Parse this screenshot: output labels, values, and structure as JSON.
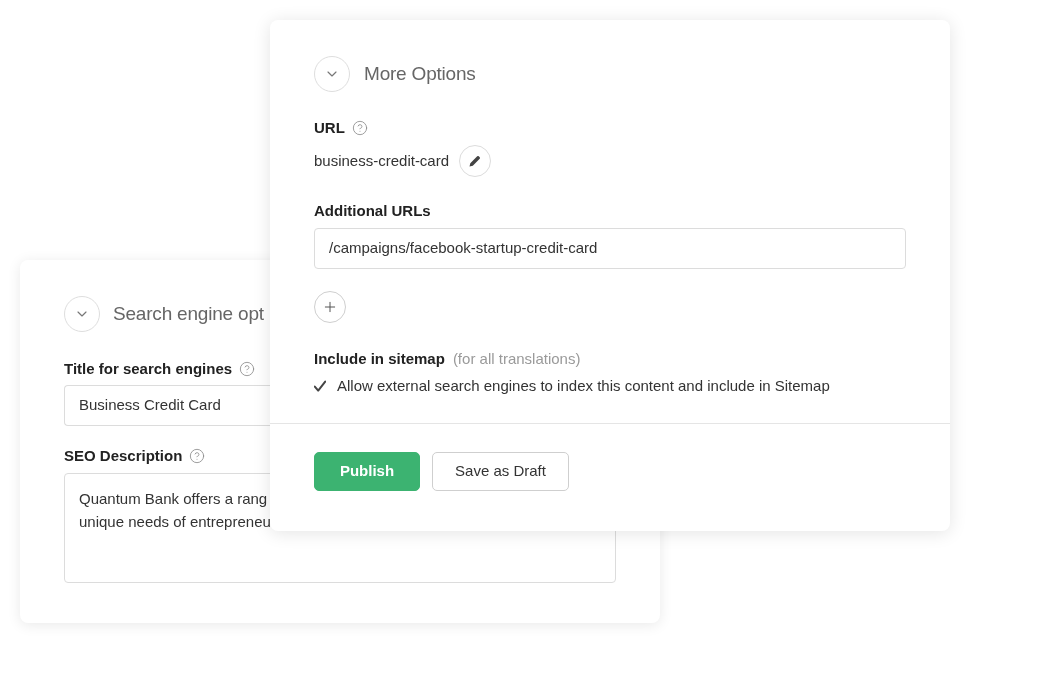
{
  "seo_panel": {
    "title": "Search engine opt",
    "title_field": {
      "label": "Title for search engines",
      "value": "Business Credit Card"
    },
    "description_field": {
      "label": "SEO Description",
      "lines": [
        "Quantum Bank offers a rang",
        "unique needs of entrepreneu"
      ]
    }
  },
  "more_options": {
    "title": "More Options",
    "url": {
      "label": "URL",
      "value": "business-credit-card"
    },
    "additional_urls": {
      "label": "Additional URLs",
      "values": [
        "/campaigns/facebook-startup-credit-card"
      ]
    },
    "sitemap": {
      "label": "Include in sitemap",
      "note": "(for all translations)",
      "option": {
        "label": "Allow external search engines to index this content and include in Sitemap",
        "checked": true
      }
    },
    "buttons": [
      {
        "label": "Publish",
        "kind": "primary"
      },
      {
        "label": "Save as Draft",
        "kind": "secondary"
      }
    ]
  }
}
